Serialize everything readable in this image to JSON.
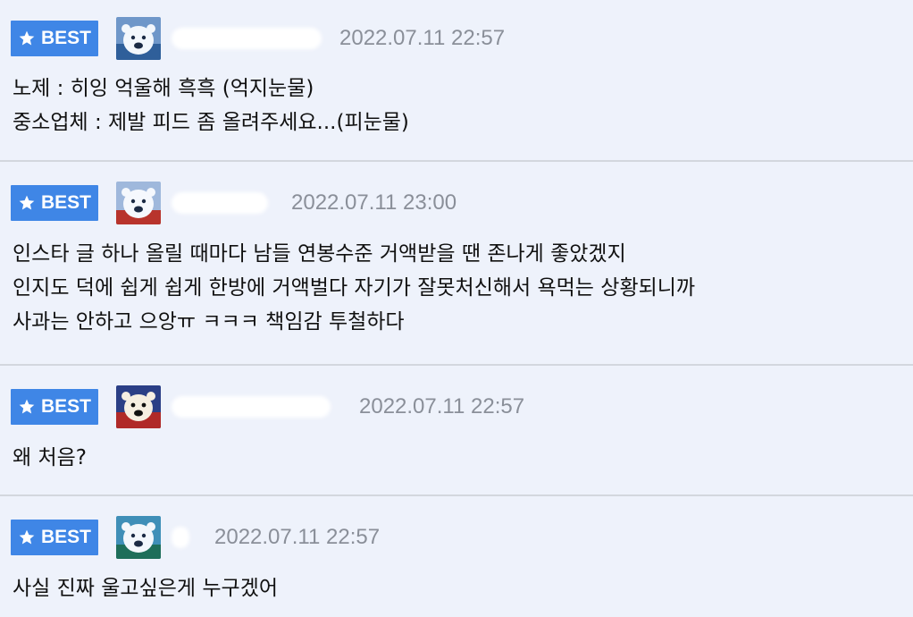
{
  "badge_label": "BEST",
  "icons": {
    "badge_icon": "star-icon",
    "avatar_icon": "polar-bear-avatar"
  },
  "colors": {
    "badge_bg": "#3f86e6",
    "page_bg": "#eef2fb",
    "date_text": "#8a8f99"
  },
  "comments": [
    {
      "date": "2022.07.11",
      "time": "22:57",
      "lines": [
        "노제 : 히잉 억울해 흑흑 (억지눈물)",
        "중소업체 : 제발 피드 좀 올려주세요...(피눈물)"
      ]
    },
    {
      "date": "2022.07.11",
      "time": "23:00",
      "lines": [
        "인스타 글 하나 올릴 때마다 남들 연봉수준 거액받을 땐 존나게 좋았겠지",
        "인지도 덕에 쉽게 쉽게 한방에 거액벌다 자기가 잘못처신해서 욕먹는 상황되니까",
        "사과는 안하고 으앙ㅠ ㅋㅋㅋ 책임감 투철하다"
      ]
    },
    {
      "date": "2022.07.11",
      "time": "22:57",
      "lines": [
        "왜 처음?"
      ]
    },
    {
      "date": "2022.07.11",
      "time": "22:57",
      "lines": [
        "사실 진짜 울고싶은게 누구겠어"
      ]
    }
  ]
}
